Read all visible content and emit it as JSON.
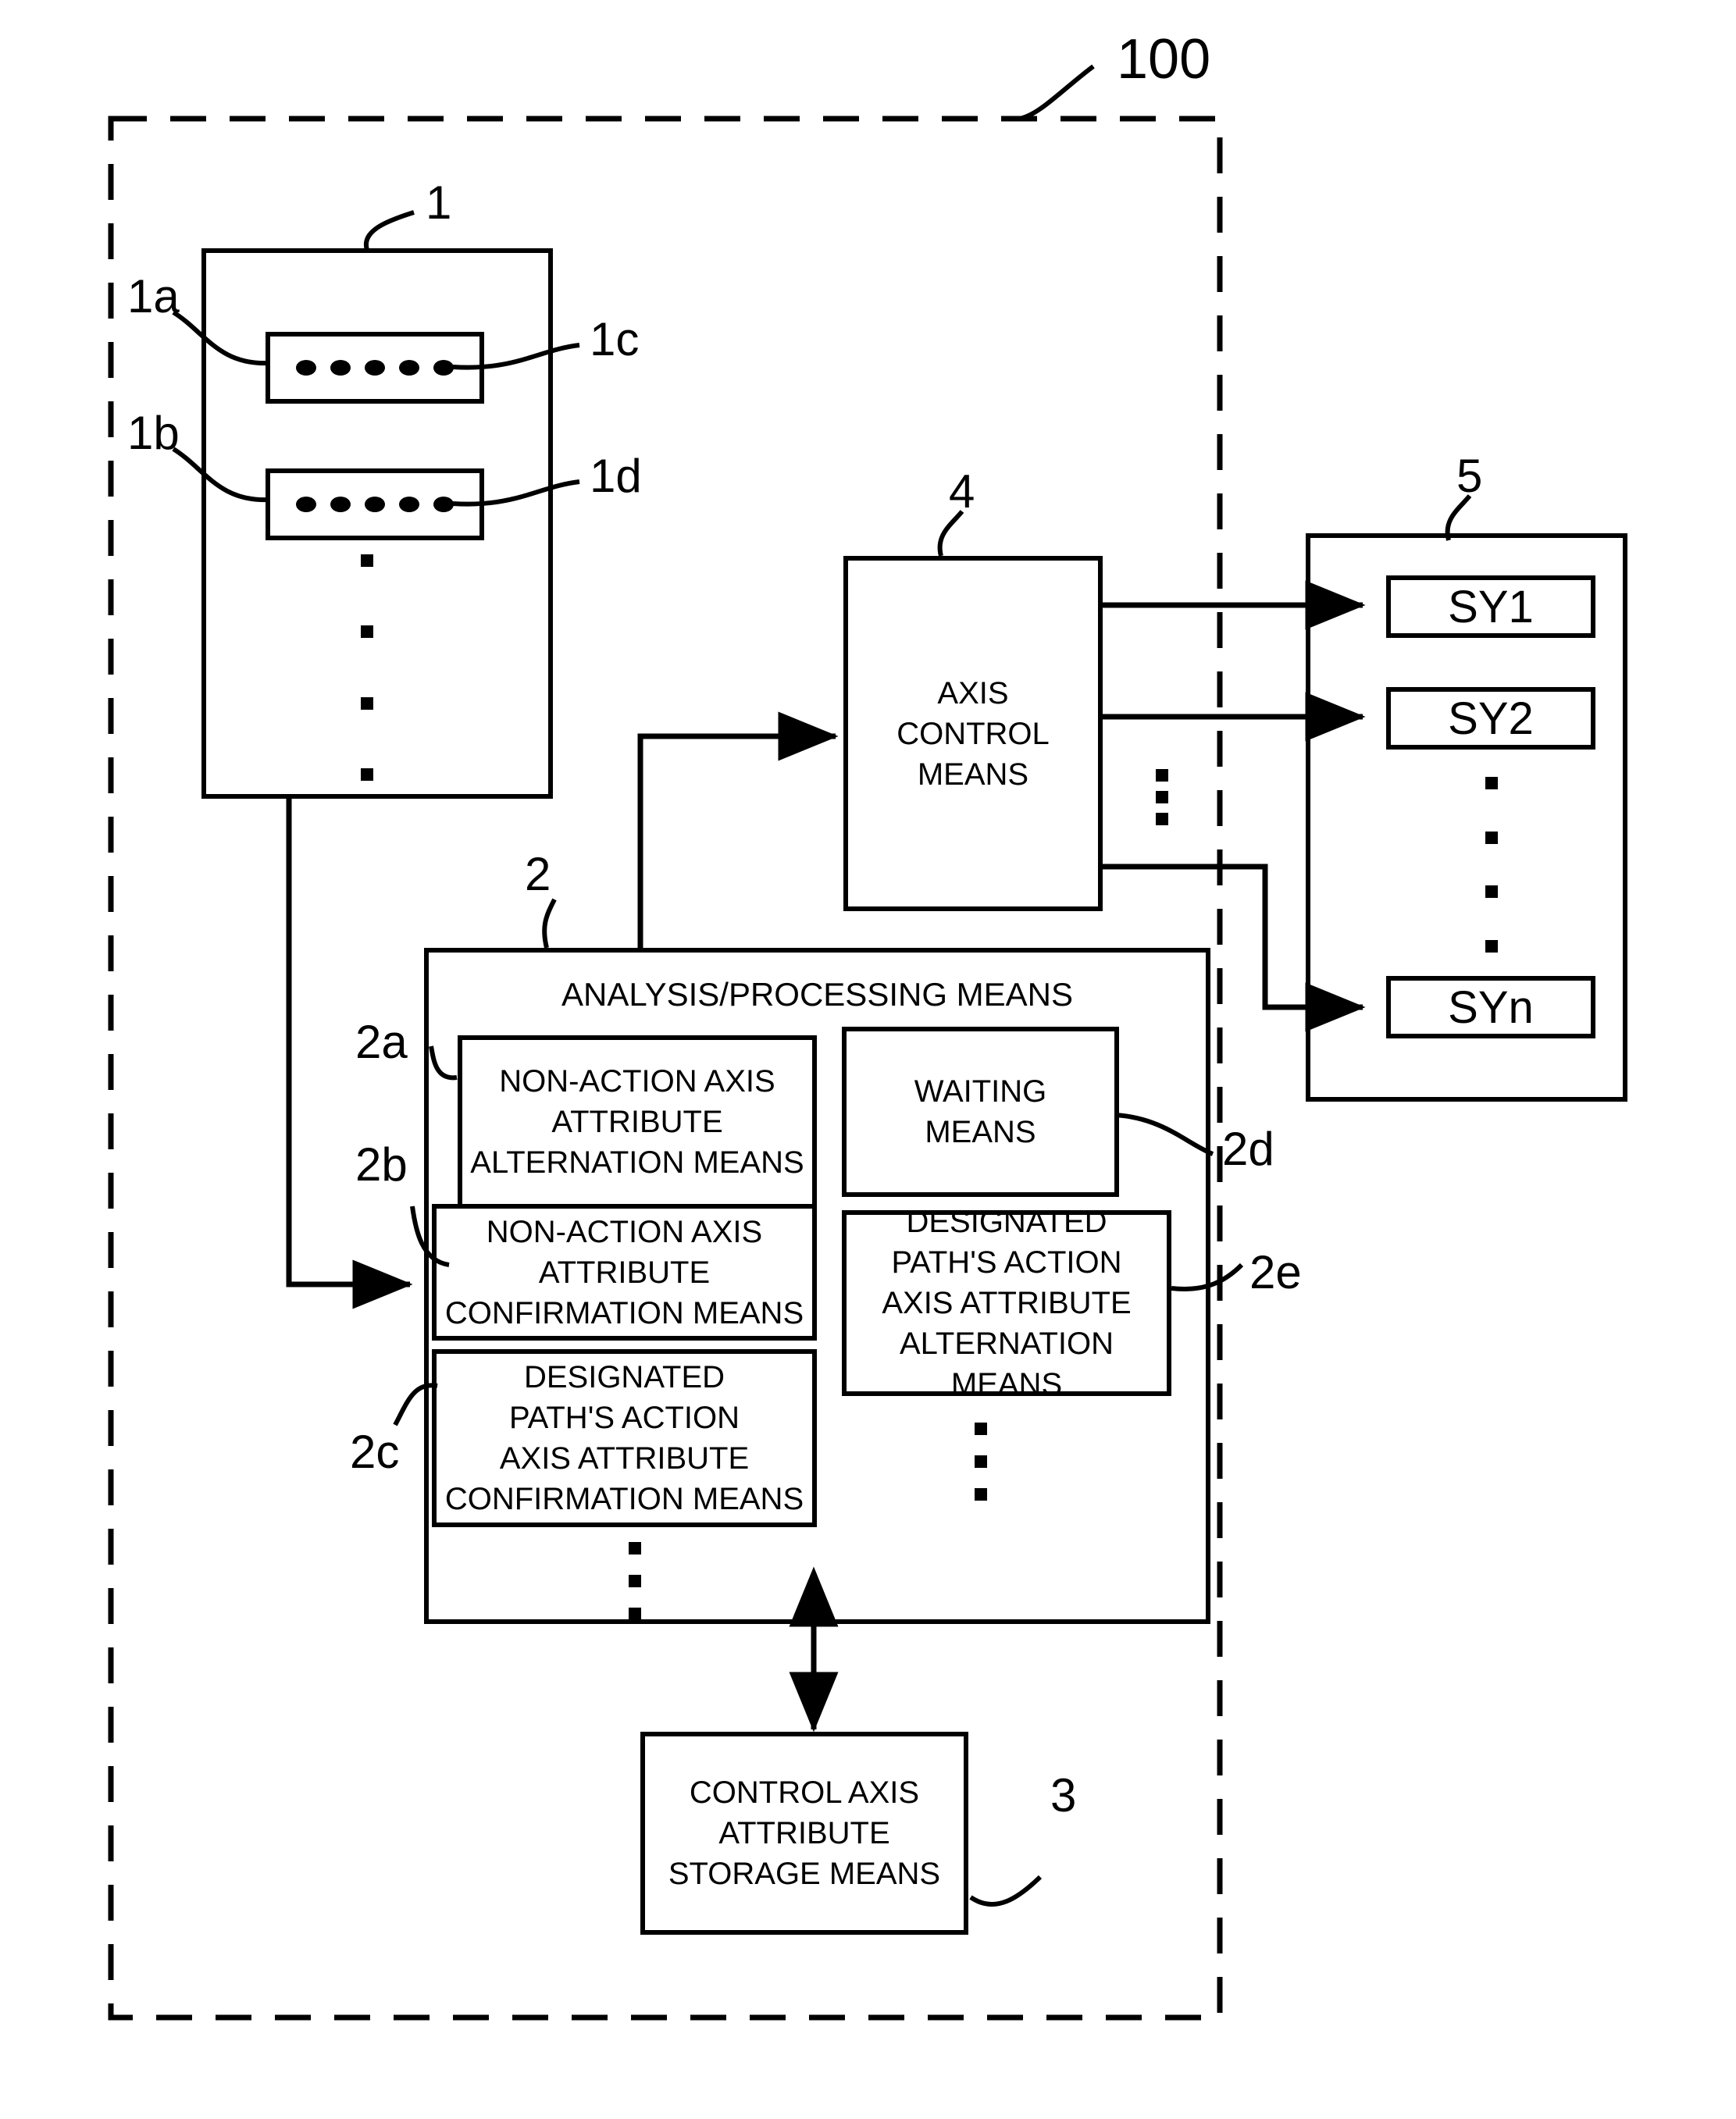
{
  "figure": {
    "system_ref": "100",
    "blocks": {
      "program_store": {
        "ref": "1",
        "inner_refs_left": [
          "1a",
          "1b"
        ],
        "inner_refs_right": [
          "1c",
          "1d"
        ],
        "dot_count_per_row": 5,
        "vertical_dot_count": 4
      },
      "analysis_processing": {
        "ref": "2",
        "title": "ANALYSIS/PROCESSING MEANS",
        "children": [
          {
            "ref": "2a",
            "label": "NON-ACTION AXIS\nATTRIBUTE\nALTERNATION MEANS"
          },
          {
            "ref": "2b",
            "label": "NON-ACTION AXIS\nATTRIBUTE\nCONFIRMATION MEANS"
          },
          {
            "ref": "2c",
            "label": "DESIGNATED\nPATH'S ACTION\nAXIS ATTRIBUTE\nCONFIRMATION MEANS"
          },
          {
            "ref": "2d",
            "label": "WAITING\nMEANS"
          },
          {
            "ref": "2e",
            "label": "DESIGNATED\nPATH'S ACTION\nAXIS ATTRIBUTE\nALTERNATION MEANS"
          }
        ]
      },
      "storage": {
        "ref": "3",
        "label": "CONTROL AXIS\nATTRIBUTE\nSTORAGE MEANS"
      },
      "axis_control": {
        "ref": "4",
        "label": "AXIS\nCONTROL\nMEANS"
      },
      "servo_group": {
        "ref": "5",
        "items": [
          "SY1",
          "SY2",
          "SYn"
        ],
        "ellipsis_dot_count": 4
      }
    },
    "colors": {
      "line": "#000000",
      "background": "#ffffff"
    }
  }
}
